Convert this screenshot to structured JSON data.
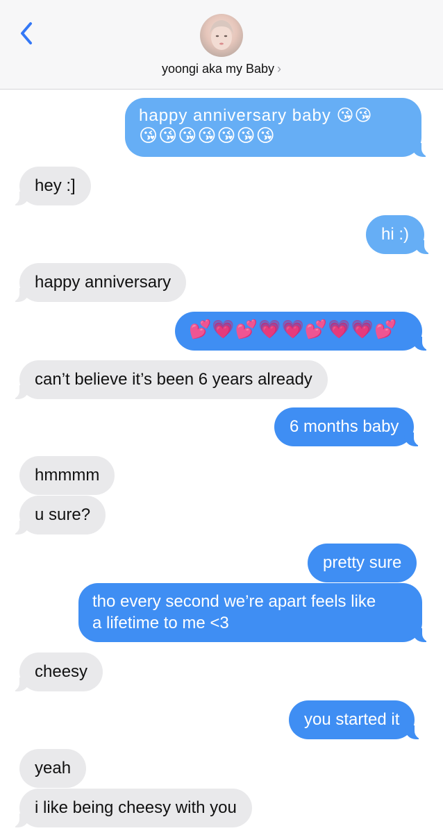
{
  "header": {
    "contact_name": "yoongi aka my Baby",
    "chevron": "›",
    "back_icon": "chevron-left-icon",
    "avatar_icon": "contact-avatar"
  },
  "colors": {
    "outgoing": "#3f8ef3",
    "outgoing_top": "#66aef5",
    "incoming": "#e9e9eb",
    "accent": "#3478f6"
  },
  "messages": [
    {
      "from": "me",
      "text_1": "happy anniversary baby 😘😘",
      "text_2": "😘😘😘😘😘😘😘"
    },
    {
      "from": "them",
      "text": "hey :]"
    },
    {
      "from": "me",
      "text": "hi :)"
    },
    {
      "from": "them",
      "text": "happy anniversary"
    },
    {
      "from": "me",
      "text": "💕💗💕💗💗💕💗💗💕"
    },
    {
      "from": "them",
      "text": "can’t believe it’s been 6 years already"
    },
    {
      "from": "me",
      "text": "6 months baby"
    },
    {
      "from": "them",
      "text": "hmmmm"
    },
    {
      "from": "them",
      "text": "u sure?"
    },
    {
      "from": "me",
      "text": "pretty sure"
    },
    {
      "from": "me",
      "text_1": "tho every second we’re apart feels like",
      "text_2": "a lifetime to me <3"
    },
    {
      "from": "them",
      "text": "cheesy"
    },
    {
      "from": "me",
      "text": "you started it"
    },
    {
      "from": "them",
      "text": "yeah"
    },
    {
      "from": "them",
      "text": "i like being cheesy with you"
    }
  ]
}
